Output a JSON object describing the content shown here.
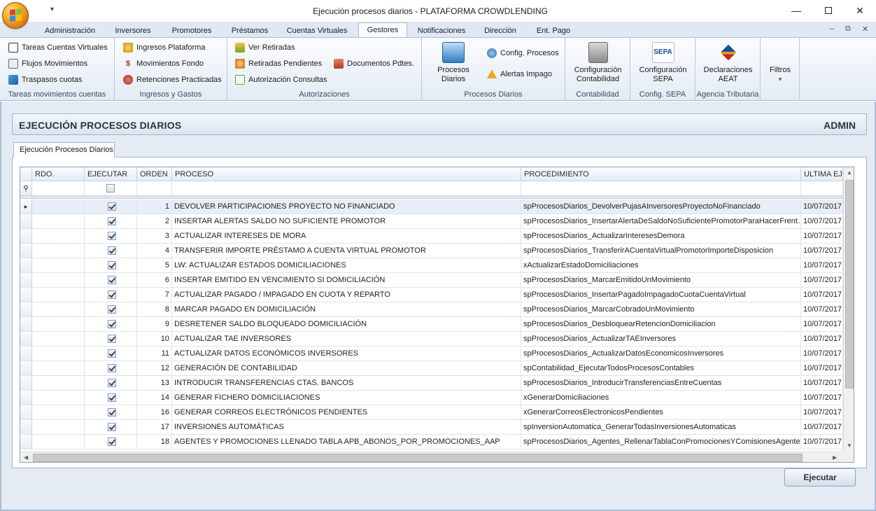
{
  "window": {
    "title": "Ejecución procesos diarios - PLATAFORMA CROWDLENDING",
    "qat": "▾"
  },
  "tabs": [
    "Administración",
    "Inversores",
    "Promotores",
    "Préstamos",
    "Cuentas Virtuales",
    "Gestores",
    "Notificaciones",
    "Dirección",
    "Ent. Pago"
  ],
  "active_tab": "Gestores",
  "ribbon": {
    "g1": {
      "label": "Tareas movimientos cuentas",
      "items": [
        "Tareas Cuentas Virtuales",
        "Flujos Movimientos",
        "Traspasos cuotas"
      ]
    },
    "g2": {
      "label": "Ingresos y Gastos",
      "items": [
        "Ingresos Plataforma",
        "Movimientos Fondo",
        "Retenciones Practicadas"
      ]
    },
    "g3": {
      "label": "Autorizaciones",
      "items": [
        "Ver Retiradas",
        "Retiradas Pendientes",
        "Autorización Consultas",
        "Documentos Pdtes."
      ]
    },
    "g4": {
      "label": "Procesos Diarios",
      "big": [
        "Procesos",
        "Diarios"
      ],
      "items": [
        "Config. Procesos",
        "Alertas Impago"
      ]
    },
    "g5": {
      "label": "Contabilidad",
      "big": [
        "Configuración",
        "Contabilidad"
      ]
    },
    "g6": {
      "label": "Config. SEPA",
      "big": [
        "Configuración",
        "SEPA"
      ],
      "logo": "SEPA"
    },
    "g7": {
      "label": "Agencia Tributaria",
      "big": [
        "Declaraciones",
        "AEAT"
      ]
    },
    "g8": {
      "label": "Filtros",
      "arrow": "▾"
    }
  },
  "header": {
    "title": "EJECUCIÓN PROCESOS DIARIOS",
    "user": "ADMIN"
  },
  "page_tab": "Ejecución Procesos Diarios",
  "grid": {
    "columns": [
      "RDO.",
      "EJECUTAR",
      "ORDEN",
      "PROCESO",
      "PROCEDIMIENTO",
      "ULTIMA EJE"
    ],
    "filter_icon": "⚲",
    "rows": [
      {
        "orden": "1",
        "proceso": "DEVOLVER PARTICIPACIONES PROYECTO NO FINANCIADO",
        "procedimiento": "spProcesosDiarios_DevolverPujasAInversoresProyectoNoFinanciado",
        "ultima": "10/07/2017"
      },
      {
        "orden": "2",
        "proceso": "INSERTAR ALERTAS SALDO NO SUFICIENTE PROMOTOR",
        "procedimiento": "spProcesosDiarios_InsertarAlertaDeSaldoNoSuficientePromotorParaHacerFrent…",
        "ultima": "10/07/2017"
      },
      {
        "orden": "3",
        "proceso": "ACTUALIZAR INTERESES DE MORA",
        "procedimiento": "spProcesosDiarios_ActualizarInteresesDemora",
        "ultima": "10/07/2017"
      },
      {
        "orden": "4",
        "proceso": "TRANSFERIR IMPORTE PRÉSTAMO A CUENTA VIRTUAL PROMOTOR",
        "procedimiento": "spProcesosDiarios_TransferirACuentaVirtualPromotorImporteDisposicion",
        "ultima": "10/07/2017"
      },
      {
        "orden": "5",
        "proceso": "LW: ACTUALIZAR ESTADOS DOMICILIACIONES",
        "procedimiento": "xActualizarEstadoDomiciliaciones",
        "ultima": "10/07/2017"
      },
      {
        "orden": "6",
        "proceso": "INSERTAR EMITIDO EN VENCIMIENTO SI DOMICILIACIÓN",
        "procedimiento": "spProcesosDiarios_MarcarEmitidoUnMovimiento",
        "ultima": "10/07/2017"
      },
      {
        "orden": "7",
        "proceso": "ACTUALIZAR PAGADO / IMPAGADO EN CUOTA Y REPARTO",
        "procedimiento": "spProcesosDiarios_InsertarPagadoImpagadoCuotaCuentaVirtual",
        "ultima": "10/07/2017"
      },
      {
        "orden": "8",
        "proceso": "MARCAR PAGADO EN DOMICILIACIÓN",
        "procedimiento": "spProcesosDiarios_MarcarCobradoUnMovimiento",
        "ultima": "10/07/2017"
      },
      {
        "orden": "9",
        "proceso": "DESRETENER SALDO BLOQUEADO DOMICILIACIÓN",
        "procedimiento": "spProcesosDiarios_DesbloquearRetencionDomiciliacion",
        "ultima": "10/07/2017"
      },
      {
        "orden": "10",
        "proceso": "ACTUALIZAR TAE INVERSORES",
        "procedimiento": "spProcesosDiarios_ActualizarTAEInversores",
        "ultima": "10/07/2017"
      },
      {
        "orden": "11",
        "proceso": "ACTUALIZAR DATOS ECONÓMICOS INVERSORES",
        "procedimiento": "spProcesosDiarios_ActualizarDatosEconomicosInversores",
        "ultima": "10/07/2017"
      },
      {
        "orden": "12",
        "proceso": "GENERACIÓN DE CONTABILIDAD",
        "procedimiento": "spContabilidad_EjecutarTodosProcesosContables",
        "ultima": "10/07/2017"
      },
      {
        "orden": "13",
        "proceso": "INTRODUCIR TRANSFERENCIAS CTAS. BANCOS",
        "procedimiento": "spProcesosDiarios_IntroducirTransferenciasEntreCuentas",
        "ultima": "10/07/2017"
      },
      {
        "orden": "14",
        "proceso": "GENERAR FICHERO DOMICILIACIONES",
        "procedimiento": "xGenerarDomiciliaciones",
        "ultima": "10/07/2017"
      },
      {
        "orden": "16",
        "proceso": "GENERAR CORREOS ELECTRÓNICOS PENDIENTES",
        "procedimiento": "xGenerarCorreosElectronicosPendientes",
        "ultima": "10/07/2017"
      },
      {
        "orden": "17",
        "proceso": "INVERSIONES AUTOMÁTICAS",
        "procedimiento": "spInversionAutomatica_GenerarTodasInversionesAutomaticas",
        "ultima": "10/07/2017"
      },
      {
        "orden": "18",
        "proceso": "AGENTES Y PROMOCIONES LLENADO TABLA APB_ABONOS_POR_PROMOCIONES_AAP",
        "procedimiento": "spProcesosDiarios_Agentes_RellenarTablaConPromocionesYComisionesAgentes",
        "ultima": "10/07/2017"
      }
    ]
  },
  "execute_button": "Ejecutar"
}
